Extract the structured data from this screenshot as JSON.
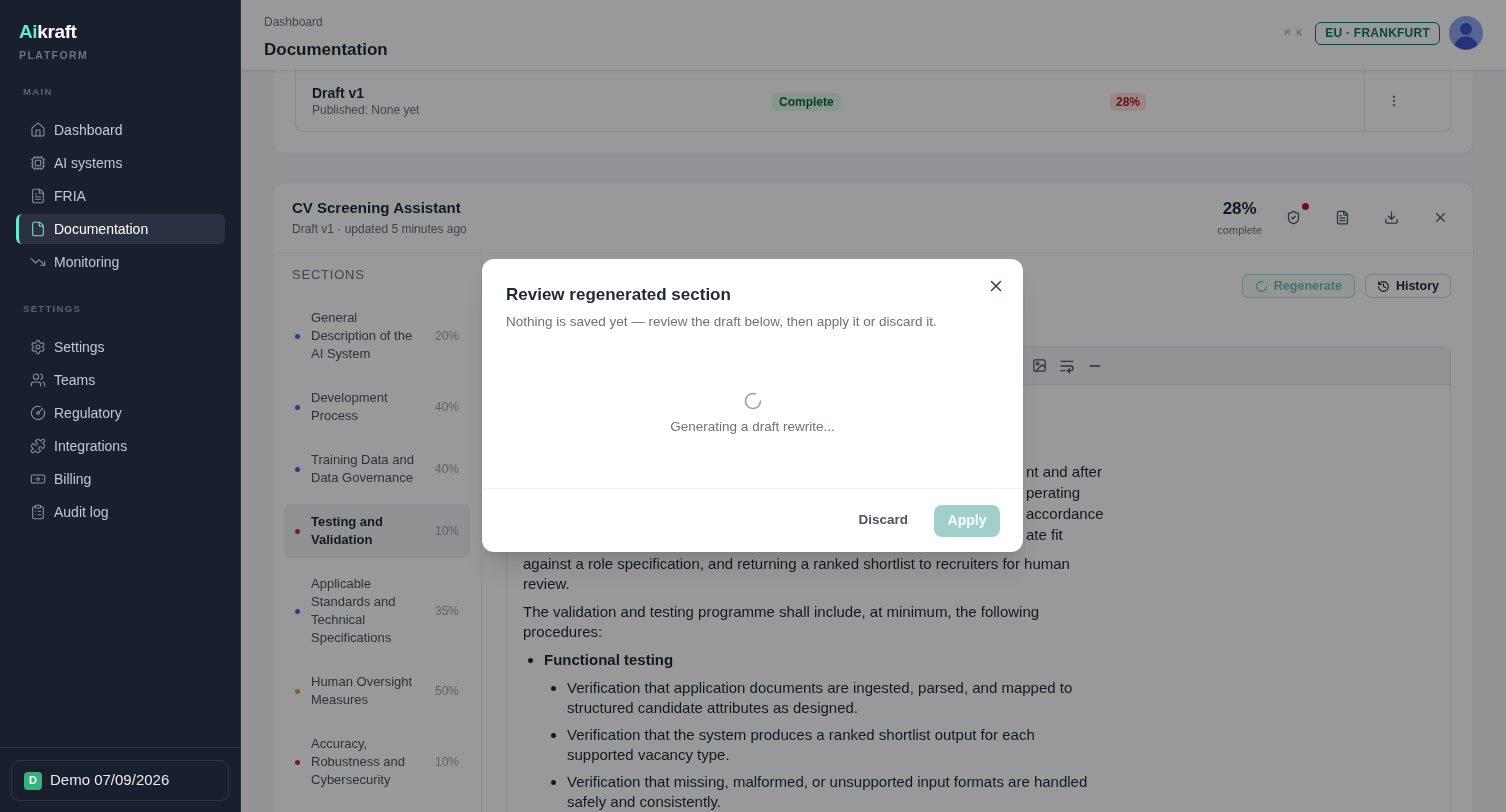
{
  "sidebar": {
    "logo": {
      "accent": "Ai",
      "rest": "kraft"
    },
    "tagline": "PLATFORM",
    "groups": [
      {
        "heading": "MAIN",
        "items": [
          {
            "label": "Dashboard",
            "selected": false
          },
          {
            "label": "AI systems",
            "selected": false
          },
          {
            "label": "FRIA",
            "selected": false
          },
          {
            "label": "Documentation",
            "selected": true
          },
          {
            "label": "Monitoring",
            "selected": false
          }
        ]
      },
      {
        "heading": "SETTINGS",
        "items": [
          {
            "label": "Settings",
            "selected": false
          },
          {
            "label": "Teams",
            "selected": false
          },
          {
            "label": "Regulatory",
            "selected": false
          },
          {
            "label": "Integrations",
            "selected": false
          },
          {
            "label": "Billing",
            "selected": false
          },
          {
            "label": "Audit log",
            "selected": false
          }
        ]
      }
    ],
    "workspace": {
      "badge": "D",
      "label": "Demo 07/09/2026"
    }
  },
  "header": {
    "breadcrumb": "Dashboard",
    "title": "Documentation",
    "shortcut": "⌘ K",
    "region": "EU · FRANKFURT"
  },
  "versions": {
    "rows": [
      {
        "name": "Draft v1",
        "published": "Published: None yet",
        "status": "Complete",
        "completion": "28%"
      }
    ]
  },
  "document": {
    "title": "CV Screening Assistant",
    "meta": "Draft v1 · updated 5 minutes ago",
    "completion": "28%",
    "completion_caption": "complete",
    "alert": true,
    "sections_heading": "SECTIONS",
    "sections": [
      {
        "title": "General Description of the AI System",
        "percent": "20%",
        "color": "#2e3b8c",
        "selected": false
      },
      {
        "title": "Development Process",
        "percent": "40%",
        "color": "#2e3b8c",
        "selected": false
      },
      {
        "title": "Training Data and Data Governance",
        "percent": "40%",
        "color": "#2e3b8c",
        "selected": false
      },
      {
        "title": "Testing and Validation",
        "percent": "10%",
        "color": "#7c1532",
        "selected": true
      },
      {
        "title": "Applicable Standards and Technical Specifications",
        "percent": "35%",
        "color": "#2e3b8c",
        "selected": false
      },
      {
        "title": "Human Oversight Measures",
        "percent": "50%",
        "color": "#8d5e1c",
        "selected": false
      },
      {
        "title": "Accuracy, Robustness and Cybersecurity",
        "percent": "10%",
        "color": "#7c1532",
        "selected": false
      }
    ],
    "actions": {
      "regenerate": {
        "label": "Regenerate",
        "disabled": true
      },
      "history": {
        "label": "History"
      }
    },
    "editor": {
      "line_fragments": [
        "nt and after",
        "perating",
        "accordance",
        "ate fit"
      ],
      "blocks": [
        {
          "kind": "paragraph",
          "text": "against a role specification, and returning a ranked shortlist to recruiters for human review."
        },
        {
          "kind": "paragraph",
          "text": "The validation and testing programme shall include, at minimum, the following procedures:"
        },
        {
          "kind": "list",
          "items": [
            {
              "text": "Functional testing",
              "children": [
                {
                  "text": "Verification that application documents are ingested, parsed, and mapped to structured candidate attributes as designed."
                },
                {
                  "text": "Verification that the system produces a ranked shortlist output for each supported vacancy type."
                },
                {
                  "text": "Verification that missing, malformed, or unsupported input formats are handled safely and consistently."
                }
              ]
            }
          ]
        }
      ]
    }
  },
  "modal": {
    "title": "Review regenerated section",
    "description": "Nothing is saved yet — review the draft below, then apply it or discard it.",
    "loading_text": "Generating a draft rewrite...",
    "buttons": [
      {
        "kind": "discard",
        "label": "Discard",
        "disabled": false
      },
      {
        "kind": "apply",
        "label": "Apply",
        "disabled": true
      }
    ]
  }
}
